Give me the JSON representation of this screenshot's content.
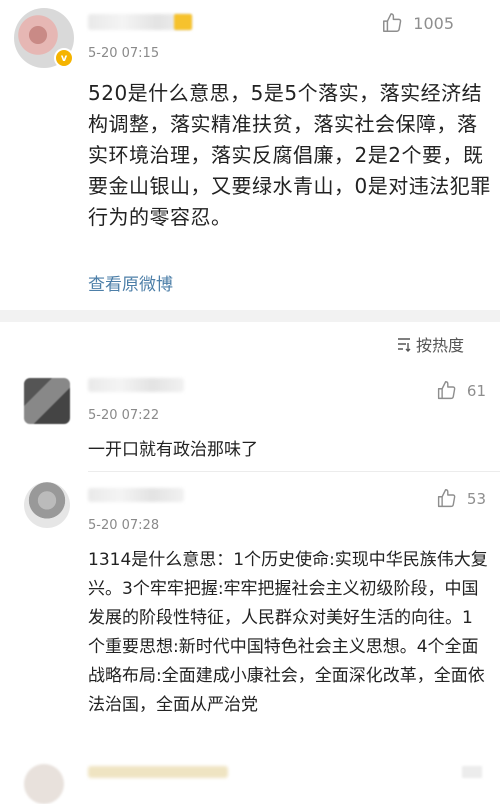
{
  "post": {
    "time": "5-20 07:15",
    "like_count": "1005",
    "text": "520是什么意思，5是5个落实，落实经济结构调整，落实精准扶贫，落实社会保障，落实环境治理，落实反腐倡廉，2是2个要，既要金山银山，又要绿水青山，0是对违法犯罪行为的零容忍。",
    "view_original": "查看原微博"
  },
  "sort": {
    "label": "按热度"
  },
  "comments": [
    {
      "time": "5-20 07:22",
      "like_count": "61",
      "text": "一开口就有政治那味了"
    },
    {
      "time": "5-20 07:28",
      "like_count": "53",
      "text": "1314是什么意思：1个历史使命:实现中华民族伟大复兴。3个牢牢把握:牢牢把握社会主义初级阶段，中国发展的阶段性特征，人民群众对美好生活的向往。1个重要思想:新时代中国特色社会主义思想。4个全面战略布局:全面建成小康社会，全面深化改革，全面依法治国，全面从严治党"
    }
  ],
  "icons": {
    "like": "thumbs-up-icon",
    "sort": "sort-icon",
    "verified": "verified-badge-icon"
  },
  "colors": {
    "link": "#4d7fa8",
    "divider": "#f2f2f2",
    "meta": "#8a8a8a"
  }
}
